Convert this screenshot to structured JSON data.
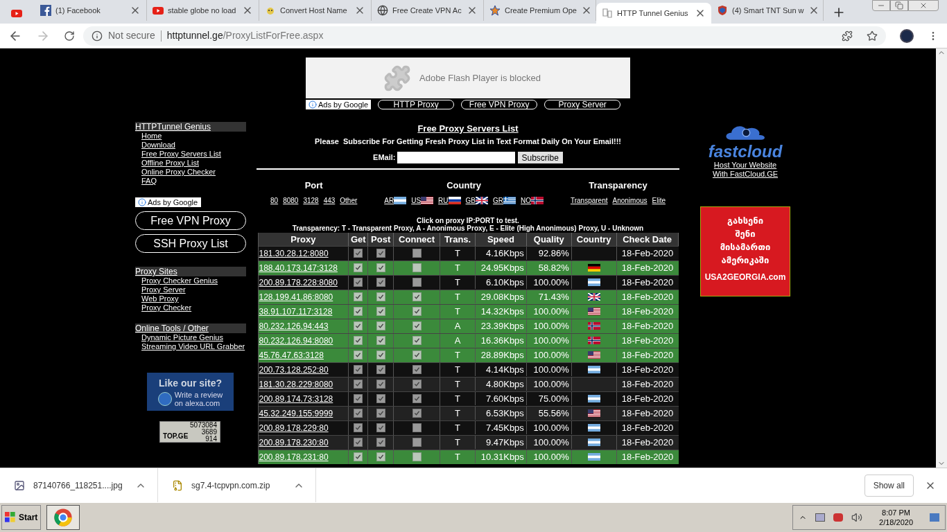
{
  "browser": {
    "tabs": [
      {
        "selected": false
      },
      {
        "title": "(1) Facebook",
        "selected": false
      },
      {
        "title": "stable globe no load",
        "selected": false
      },
      {
        "title": "Convert Host Name",
        "selected": false
      },
      {
        "title": "Free Create VPN Ac",
        "selected": false
      },
      {
        "title": "Create Premium Ope",
        "selected": false
      },
      {
        "title": "HTTP Tunnel Genius",
        "selected": true
      },
      {
        "title": "(4) Smart TNT Sun w",
        "selected": false
      }
    ],
    "security": "Not secure",
    "url_host": "httptunnel.ge",
    "url_path": "/ProxyListForFree.aspx"
  },
  "top_ad": {
    "message": "Adobe Flash Player is blocked",
    "ads_label": "Ads by Google",
    "buttons": [
      "HTTP Proxy",
      "Free VPN Proxy",
      "Proxy Server"
    ]
  },
  "sidebar": {
    "sections": [
      {
        "title": "HTTPTunnel Genius",
        "links": [
          "Home",
          "Download",
          "Free Proxy Servers List",
          "Offline Proxy List",
          "Online Proxy Checker",
          "FAQ"
        ]
      },
      {
        "title": "Proxy Sites",
        "links": [
          "Proxy Checker Genius",
          "Proxy Server",
          "Web Proxy",
          "Proxy Checker"
        ]
      },
      {
        "title": "Online Tools / Other",
        "links": [
          "Dynamic Picture Genius",
          "Streaming Video URL Grabber"
        ]
      }
    ],
    "ads_label": "Ads by Google",
    "ad_buttons": [
      "Free VPN Proxy",
      "SSH Proxy List"
    ],
    "alexa": {
      "title": "Like our site?",
      "lines": [
        "Write a review",
        "on alexa.com"
      ]
    },
    "counter": {
      "logo": "TOP.GE",
      "values": [
        "5073084",
        "3689",
        "914"
      ]
    }
  },
  "main": {
    "title": "Free Proxy Servers List",
    "subtitle": "Please  Subscribe For Getting Fresh Proxy List in Text Format Daily On Your Email!!!",
    "email_label": "EMail:",
    "subscribe": "Subscribe",
    "filters": [
      {
        "heading": "Port",
        "links": [
          {
            "label": "80"
          },
          {
            "label": "8080"
          },
          {
            "label": "3128"
          },
          {
            "label": "443"
          },
          {
            "label": "Other"
          }
        ]
      },
      {
        "heading": "Country",
        "links": [
          {
            "label": "AR",
            "kind": "ar"
          },
          {
            "label": "US",
            "kind": "us"
          },
          {
            "label": "RU",
            "kind": "ru"
          },
          {
            "label": "GB",
            "kind": "gb"
          },
          {
            "label": "GR",
            "kind": "gr"
          },
          {
            "label": "NO",
            "kind": "no"
          }
        ]
      },
      {
        "heading": "Transparency",
        "links": [
          {
            "label": "Transparent"
          },
          {
            "label": "Anonimous"
          },
          {
            "label": "Elite"
          }
        ]
      }
    ],
    "note": "Click on proxy IP:PORT to test.",
    "legend": "Transparency: T - Transparent Proxy, A - Anonimous Proxy, E - Elite (High Anonimous) Proxy, U - Unknown",
    "table": {
      "columns": [
        "Proxy",
        "Get",
        "Post",
        "Connect",
        "Trans.",
        "Speed",
        "Quality",
        "Country",
        "Check Date"
      ],
      "rows": [
        {
          "proxy": "181.30.28.12:8080",
          "get": true,
          "post": true,
          "connect": false,
          "trans": "T",
          "speed": "4.16Kbps",
          "quality": "92.86%",
          "date": "18-Feb-2020",
          "highlighted": false
        },
        {
          "proxy": "188.40.173.147:3128",
          "get": true,
          "post": true,
          "connect": false,
          "trans": "T",
          "speed": "24.95Kbps",
          "quality": "58.82%",
          "kind": "de",
          "date": "18-Feb-2020",
          "highlighted": true
        },
        {
          "proxy": "200.89.178.228:8080",
          "get": true,
          "post": true,
          "connect": false,
          "trans": "T",
          "speed": "6.10Kbps",
          "quality": "100.00%",
          "kind": "ar",
          "date": "18-Feb-2020",
          "highlighted": false
        },
        {
          "proxy": "128.199.41.86:8080",
          "get": true,
          "post": true,
          "connect": true,
          "trans": "T",
          "speed": "29.08Kbps",
          "quality": "71.43%",
          "kind": "gb",
          "date": "18-Feb-2020",
          "highlighted": true
        },
        {
          "proxy": "38.91.107.117:3128",
          "get": true,
          "post": true,
          "connect": true,
          "trans": "T",
          "speed": "14.32Kbps",
          "quality": "100.00%",
          "kind": "us",
          "date": "18-Feb-2020",
          "highlighted": true
        },
        {
          "proxy": "80.232.126.94:443",
          "get": true,
          "post": true,
          "connect": true,
          "trans": "A",
          "speed": "23.39Kbps",
          "quality": "100.00%",
          "kind": "no",
          "date": "18-Feb-2020",
          "highlighted": true
        },
        {
          "proxy": "80.232.126.94:8080",
          "get": true,
          "post": true,
          "connect": true,
          "trans": "A",
          "speed": "16.36Kbps",
          "quality": "100.00%",
          "kind": "no",
          "date": "18-Feb-2020",
          "highlighted": true
        },
        {
          "proxy": "45.76.47.63:3128",
          "get": true,
          "post": true,
          "connect": true,
          "trans": "T",
          "speed": "28.89Kbps",
          "quality": "100.00%",
          "kind": "us",
          "date": "18-Feb-2020",
          "highlighted": true
        },
        {
          "proxy": "200.73.128.252:80",
          "get": true,
          "post": true,
          "connect": true,
          "trans": "T",
          "speed": "4.14Kbps",
          "quality": "100.00%",
          "kind": "ar",
          "date": "18-Feb-2020",
          "highlighted": false
        },
        {
          "proxy": "181.30.28.229:8080",
          "get": true,
          "post": true,
          "connect": true,
          "trans": "T",
          "speed": "4.80Kbps",
          "quality": "100.00%",
          "date": "18-Feb-2020",
          "highlighted": false
        },
        {
          "proxy": "200.89.174.73:3128",
          "get": true,
          "post": true,
          "connect": true,
          "trans": "T",
          "speed": "7.60Kbps",
          "quality": "75.00%",
          "kind": "ar",
          "date": "18-Feb-2020",
          "highlighted": false
        },
        {
          "proxy": "45.32.249.155:9999",
          "get": true,
          "post": true,
          "connect": true,
          "trans": "T",
          "speed": "6.53Kbps",
          "quality": "55.56%",
          "kind": "us",
          "date": "18-Feb-2020",
          "highlighted": false
        },
        {
          "proxy": "200.89.178.229:80",
          "get": true,
          "post": true,
          "connect": false,
          "trans": "T",
          "speed": "7.45Kbps",
          "quality": "100.00%",
          "kind": "ar",
          "date": "18-Feb-2020",
          "highlighted": false
        },
        {
          "proxy": "200.89.178.230:80",
          "get": true,
          "post": true,
          "connect": false,
          "trans": "T",
          "speed": "9.47Kbps",
          "quality": "100.00%",
          "kind": "ar",
          "date": "18-Feb-2020",
          "highlighted": false
        },
        {
          "proxy": "200.89.178.231:80",
          "get": true,
          "post": true,
          "connect": false,
          "trans": "T",
          "speed": "10.31Kbps",
          "quality": "100.00%",
          "kind": "ar",
          "date": "18-Feb-2020",
          "highlighted": true
        }
      ]
    }
  },
  "right": {
    "logo": "fastcloud",
    "links": [
      "Host Your Website",
      "With FastCloud.GE"
    ],
    "ad": {
      "lines": [
        "გახსენი",
        "შენი",
        "მისამართი",
        "ამერიკაში"
      ],
      "site": "USA2GEORGIA.com"
    }
  },
  "downloads": {
    "items": [
      {
        "name": "87140766_118251....jpg",
        "kind": "image"
      },
      {
        "name": "sg7.4-tcpvpn.com.zip",
        "kind": "archive"
      }
    ],
    "show_all": "Show all"
  },
  "taskbar": {
    "start": "Start",
    "time": "8:07 PM",
    "date": "2/18/2020"
  }
}
